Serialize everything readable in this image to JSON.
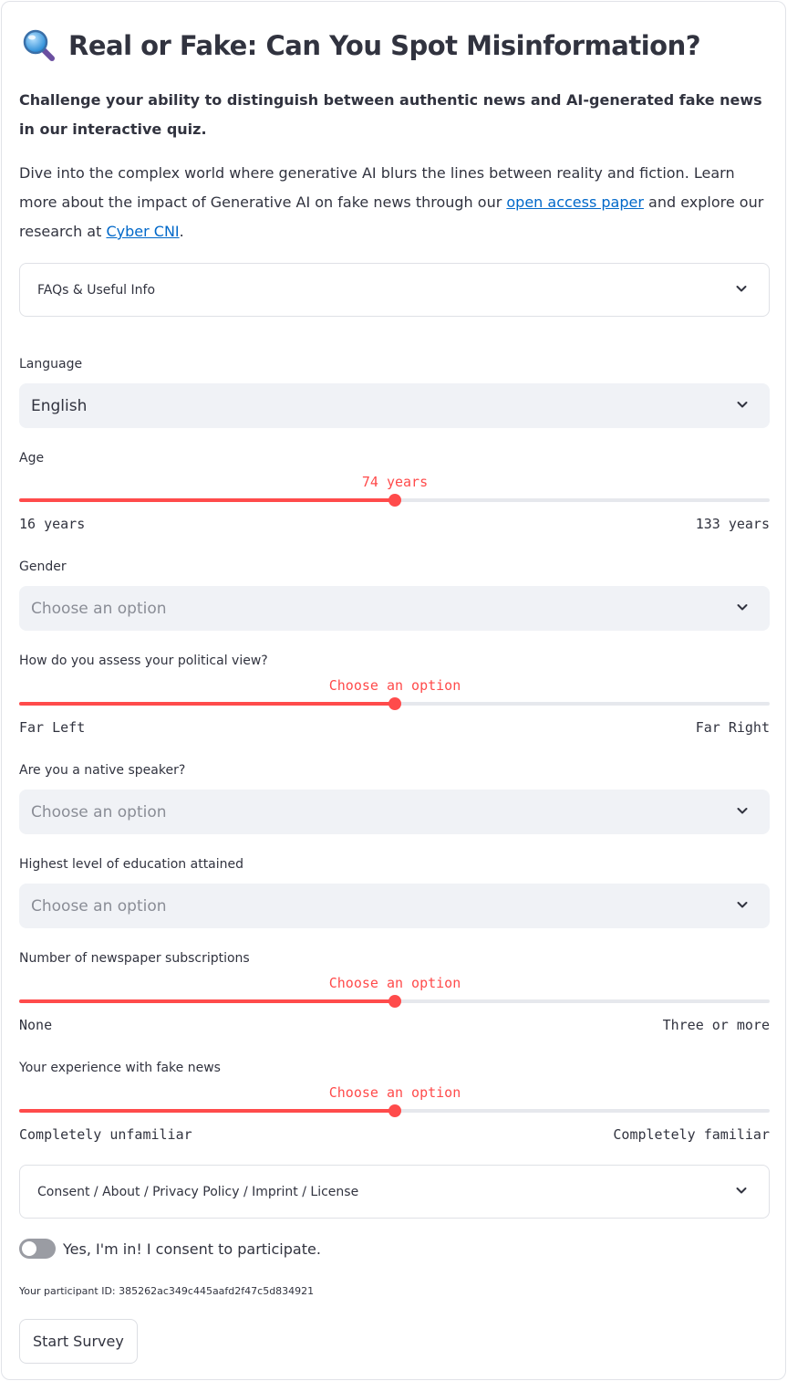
{
  "header": {
    "icon": "magnifying-glass-icon",
    "title": "Real or Fake: Can You Spot Misinformation?"
  },
  "lead": "Challenge your ability to distinguish between authentic news and AI-generated fake news in our interactive quiz.",
  "intro": {
    "text_1": "Dive into the complex world where generative AI blurs the lines between reality and fiction. Learn more about the impact of Generative AI on fake news through our ",
    "link_1": "open access paper",
    "text_2": " and explore our research at ",
    "link_2": "Cyber CNI",
    "text_3": "."
  },
  "faq_expander": {
    "label": "FAQs & Useful Info"
  },
  "form": {
    "language": {
      "label": "Language",
      "value": "English"
    },
    "age": {
      "label": "Age",
      "value_text": "74 years",
      "min": "16 years",
      "max": "133 years",
      "fraction": 0.5
    },
    "gender": {
      "label": "Gender",
      "placeholder": "Choose an option"
    },
    "political": {
      "label": "How do you assess your political view?",
      "value_text": "Choose an option",
      "min": "Far Left",
      "max": "Far Right",
      "fraction": 0.5
    },
    "native": {
      "label": "Are you a native speaker?",
      "placeholder": "Choose an option"
    },
    "education": {
      "label": "Highest level of education attained",
      "placeholder": "Choose an option"
    },
    "subscriptions": {
      "label": "Number of newspaper subscriptions",
      "value_text": "Choose an option",
      "min": "None",
      "max": "Three or more",
      "fraction": 0.5
    },
    "experience": {
      "label": "Your experience with fake news",
      "value_text": "Choose an option",
      "min": "Completely unfamiliar",
      "max": "Completely familiar",
      "fraction": 0.5
    }
  },
  "consent_expander": {
    "label": "Consent / About / Privacy Policy / Imprint / License"
  },
  "consent_toggle": {
    "label": "Yes, I'm in! I consent to participate.",
    "on": false
  },
  "participant": {
    "text": "Your participant ID: 385262ac349c445aafd2f47c5d834921"
  },
  "start_button": {
    "label": "Start Survey"
  },
  "colors": {
    "accent": "#ff4b4b",
    "link": "#0068c9",
    "select_bg": "#f0f2f6",
    "text": "#31333f"
  }
}
